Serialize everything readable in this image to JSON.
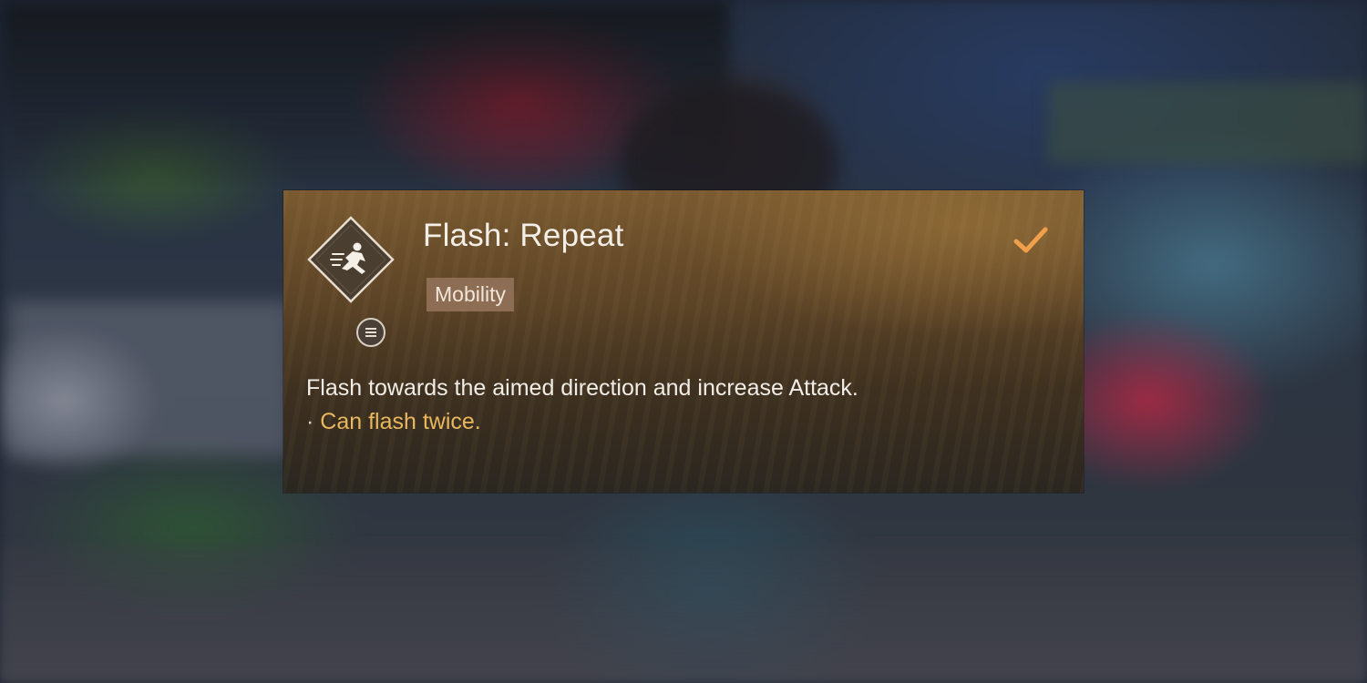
{
  "skill": {
    "title": "Flash: Repeat",
    "tag": "Mobility",
    "description": "Flash towards the aimed direction and increase Attack.",
    "bullet_marker": "·",
    "bullet": "Can flash twice.",
    "icon": "dashing-figure-icon",
    "type_badge_icon": "list-icon",
    "status_icon": "checkmark-icon",
    "equipped": true
  },
  "colors": {
    "check": "#f0a04b",
    "bullet_text": "#e9b75c",
    "tag_bg": "#8e6d55"
  }
}
